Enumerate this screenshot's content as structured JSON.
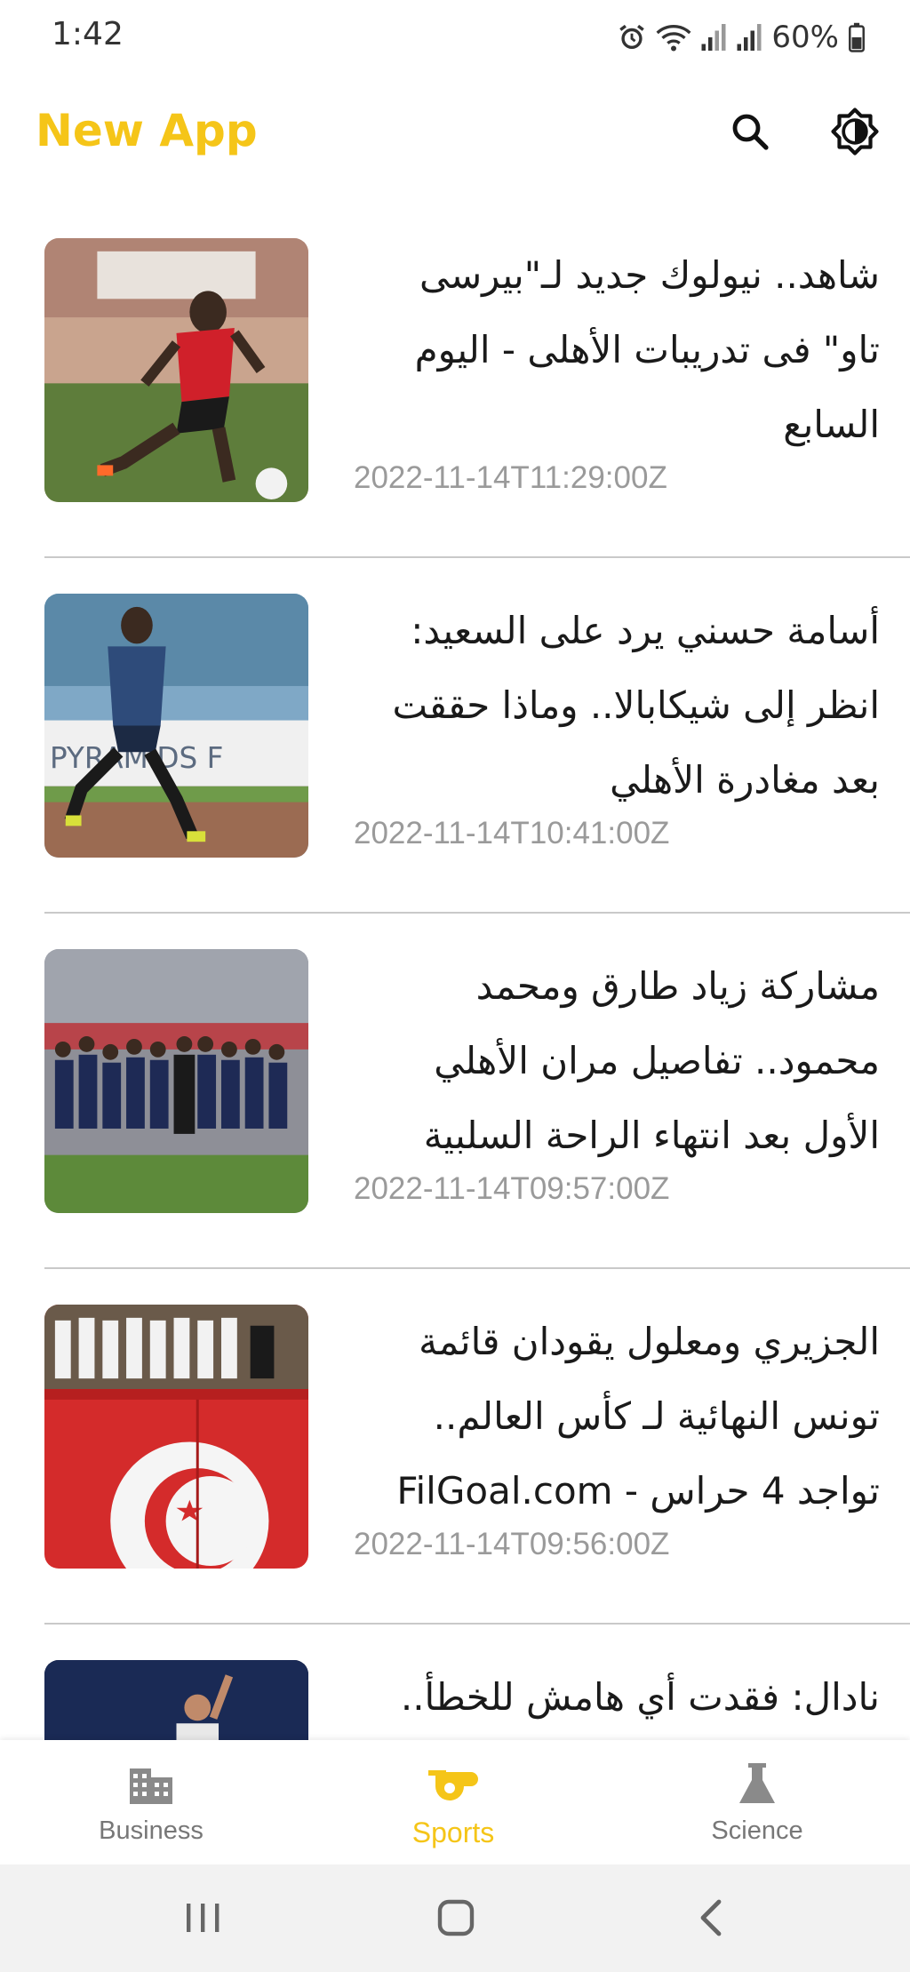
{
  "status_bar": {
    "time": "1:42",
    "battery": "60%",
    "icons": [
      "alarm-icon",
      "wifi-icon",
      "signal-icon",
      "signal-icon",
      "battery-icon"
    ]
  },
  "app_bar": {
    "title": "New App",
    "title_color": "#f5c518",
    "actions": [
      "search-icon",
      "brightness-icon"
    ]
  },
  "articles": [
    {
      "title": "شاهد.. نيولوك جديد لـ\"بيرسى تاو\" فى تدريبات الأهلى - اليوم السابع",
      "date": "2022-11-14T11:29:00Z"
    },
    {
      "title": "أسامة حسني يرد على السعيد: انظر إلى شيكابالا.. وماذا حققت بعد مغادرة الأهلي",
      "date": "2022-11-14T10:41:00Z"
    },
    {
      "title": "مشاركة زياد طارق ومحمد محمود.. تفاصيل مران الأهلي الأول بعد انتهاء الراحة السلبية",
      "date": "2022-11-14T09:57:00Z"
    },
    {
      "title": "الجزيري ومعلول يقودان قائمة تونس النهائية لـ كأس العالم.. تواجد 4 حراس - FilGoal.com",
      "date": "2022-11-14T09:56:00Z"
    },
    {
      "title": "نادال: فقدت أي هامش للخطأ..",
      "date": ""
    }
  ],
  "bottom_nav": {
    "items": [
      {
        "label": "Business",
        "icon": "building-icon"
      },
      {
        "label": "Sports",
        "icon": "whistle-icon",
        "active": true
      },
      {
        "label": "Science",
        "icon": "flask-icon"
      }
    ],
    "active_color": "#f5c518"
  },
  "system_nav": [
    "recents-icon",
    "home-icon",
    "back-icon"
  ]
}
